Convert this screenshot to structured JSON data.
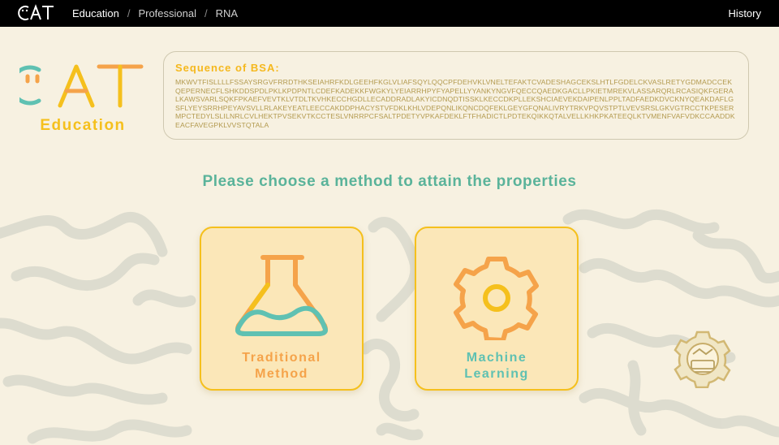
{
  "nav": {
    "logo_text": "CAT",
    "breadcrumbs": [
      "Education",
      "Professional",
      "RNA"
    ],
    "separator": "/",
    "history_label": "History"
  },
  "brand": {
    "word": "Education"
  },
  "sequence": {
    "title": "Sequence of BSA:",
    "text": "MKWVTFISLLLLFSSAYSRGVFRRDTHKSEIAHRFKDLGEEHFKGLVLIAFSQYLQQCPFDEHVKLVNELTEFAKTCVADESHAGCEKSLHTLFGDELCKVASLRETYGDMADCCEKQEPERNECFLSHKDDSPDLPKLKPDPNTLCDEFKADEKKFWGKYLYEIARRHPYFYAPELLYYANKYNGVFQECCQAEDKGACLLPKIETMREKVLASSARQRLRCASIQKFGERALKAWSVARLSQKFPKAEFVEVTKLVTDLTKVHKECCHGDLLECADDRADLAKYICDNQDTISSKLKECCDKPLLEKSHCIAEVEKDAIPENLPPLTADFAEDKDVCKNYQEAKDAFLGSFLYEYSRRHPEYAVSVLLRLAKEYEATLEECCAKDDPHACYSTVFDKLKHLVDEPQNLIKQNCDQFEKLGEYGFQNALIVRYTRKVPQVSTPTLVEVSRSLGKVGTRCCTKPESERMPCTEDYLSLILNRLCVLHEKTPVSEKVTKCCTESLVNRRPCFSALTPDETYVPKAFDEKLFTFHADICTLPDTEKQIKKQTALVELLKHKPKATEEQLKTVMENFVAFVDKCCAADDKEACFAVEGPKLVVSTQTALA"
  },
  "prompt": "Please choose a method to attain the properties",
  "methods": [
    {
      "label_line1": "Traditional",
      "label_line2": "Method",
      "icon": "flask-icon",
      "color": "#f5a34a"
    },
    {
      "label_line1": "Machine",
      "label_line2": "Learning",
      "icon": "gear-icon",
      "color": "#5fc1b2"
    }
  ],
  "colors": {
    "yellow": "#f5c01d",
    "orange": "#f5a34a",
    "teal": "#5fc1b2",
    "background": "#f7f1e1",
    "card": "#fbe7b8"
  }
}
